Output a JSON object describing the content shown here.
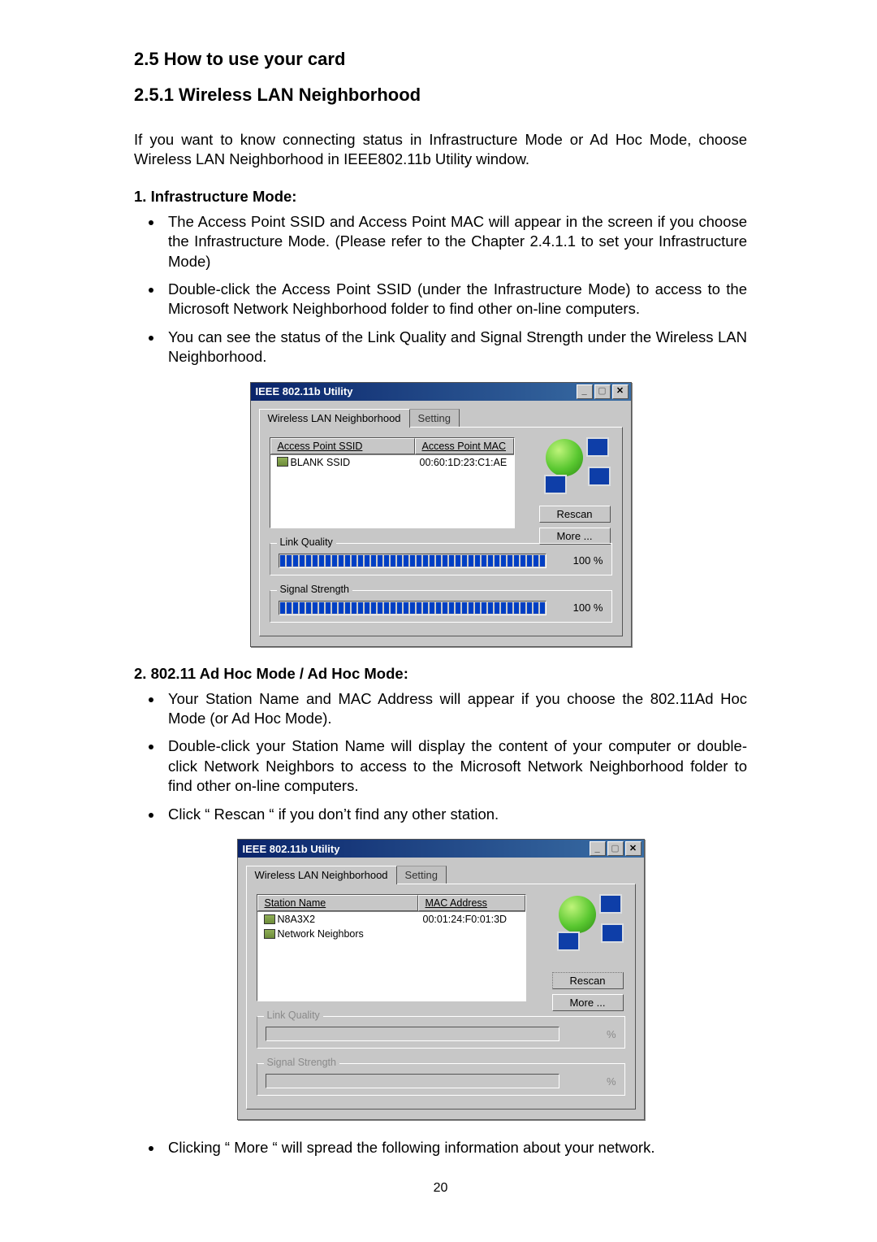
{
  "heading_section": "2.5 How to use your card",
  "heading_subsection": "2.5.1 Wireless LAN Neighborhood",
  "intro": "If you want to know connecting status in Infrastructure Mode or Ad Hoc Mode, choose Wireless LAN Neighborhood in IEEE802.11b Utility window.",
  "infra": {
    "heading": "1. Infrastructure Mode:",
    "bullets": [
      "The Access Point SSID and Access Point MAC will appear in the screen if you choose the Infrastructure Mode. (Please refer to the Chapter 2.4.1.1 to set your Infrastructure Mode)",
      "Double-click the Access Point SSID (under the Infrastructure Mode) to access to the Microsoft Network Neighborhood folder to find other on-line computers.",
      "You can see the status of the Link Quality and Signal Strength under the Wireless LAN Neighborhood."
    ]
  },
  "adhoc": {
    "heading": "2. 802.11 Ad Hoc Mode / Ad Hoc Mode:",
    "bullets": [
      "Your Station Name and MAC Address will appear if you choose the 802.11Ad Hoc Mode (or Ad Hoc Mode).",
      " Double-click your Station Name will display the content of your computer or double-click Network Neighbors to access to the Microsoft Network Neighborhood folder to find other on-line computers.",
      "Click  “ Rescan “ if you don’t find any other station."
    ]
  },
  "closing_bullet": "Clicking  “ More “ will spread the following information about your network.",
  "win_title": "IEEE 802.11b Utility",
  "tabs": {
    "neighborhood": "Wireless LAN Neighborhood",
    "setting": "Setting"
  },
  "shot1": {
    "col1": "Access Point SSID",
    "col2": "Access Point MAC",
    "rows": [
      {
        "ssid": "BLANK SSID",
        "mac": "00:60:1D:23:C1:AE"
      }
    ],
    "rescan": "Rescan",
    "more": "More ...",
    "link_quality_label": "Link Quality",
    "signal_strength_label": "Signal Strength",
    "link_quality_pct": "100  %",
    "signal_strength_pct": "100  %"
  },
  "shot2": {
    "col1": "Station Name",
    "col2": "MAC Address",
    "rows": [
      {
        "name": "N8A3X2",
        "mac": "00:01:24:F0:01:3D"
      },
      {
        "name": "Network Neighbors",
        "mac": ""
      }
    ],
    "rescan": "Rescan",
    "more": "More ...",
    "link_quality_label": "Link Quality",
    "signal_strength_label": "Signal Strength",
    "link_quality_pct": "%",
    "signal_strength_pct": "%"
  },
  "page_number": "20"
}
